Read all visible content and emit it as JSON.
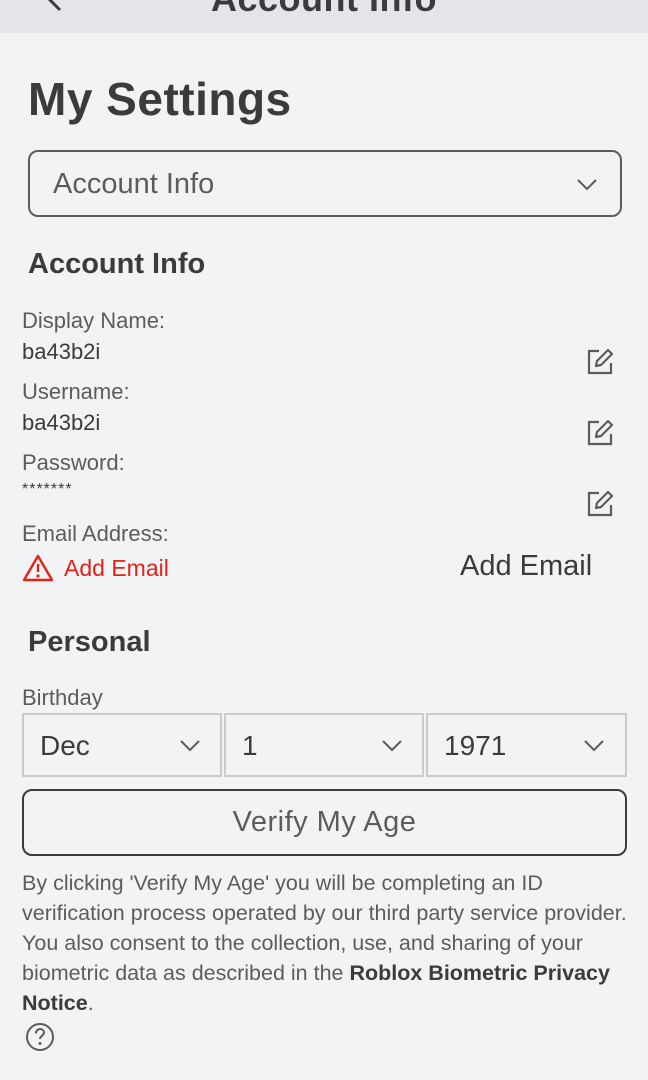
{
  "header": {
    "title": "Account Info"
  },
  "page_title": "My Settings",
  "settings_dropdown": {
    "selected": "Account Info"
  },
  "account_info": {
    "title": "Account Info",
    "display_name_label": "Display Name:",
    "display_name_value": "ba43b2i",
    "username_label": "Username:",
    "username_value": "ba43b2i",
    "password_label": "Password:",
    "password_value": "*******",
    "email_label": "Email Address:",
    "email_warning": "Add Email",
    "add_email_button": "Add Email"
  },
  "personal": {
    "title": "Personal",
    "birthday_label": "Birthday",
    "month": "Dec",
    "day": "1",
    "year": "1971",
    "verify_button": "Verify My Age",
    "disclaimer_text": "By clicking 'Verify My Age' you will be completing an ID verification process operated by our third party service provider. You also consent to the collection, use, and sharing of your biometric data as described in the ",
    "privacy_link": "Roblox Biometric Privacy Notice",
    "disclaimer_end": "."
  },
  "colors": {
    "background": "#f2f3f5",
    "text": "#393b3d",
    "warning": "#e2231a"
  },
  "icons": [
    "back-arrow-icon",
    "chevron-down-icon",
    "edit-icon",
    "warning-icon",
    "help-icon"
  ]
}
